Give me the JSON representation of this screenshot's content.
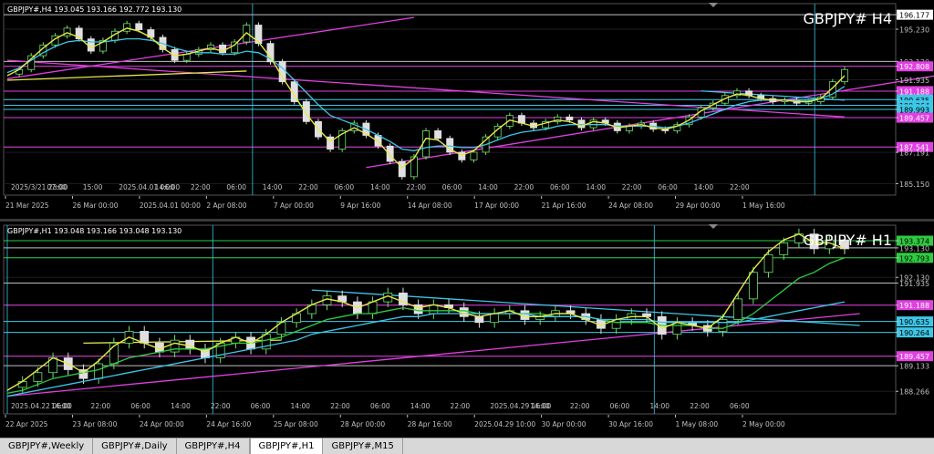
{
  "tabs": [
    "GBPJPY#,Weekly",
    "GBPJPY#,Daily",
    "GBPJPY#,H4",
    "GBPJPY#,H1",
    "GBPJPY#,M15"
  ],
  "active_tab": 3,
  "colors": {
    "bg": "#000000",
    "grid": "#2a2a2a",
    "axis": "#c0c0c0",
    "magenta": "#e040e0",
    "cyan": "#3ec6e6",
    "yellow": "#e8e84a",
    "green": "#2ecc40",
    "candle_up": "#6ee26e",
    "candle_dn": "#e0e0e0",
    "white_line": "#bbbbbb"
  },
  "charts": [
    {
      "id": "h4",
      "header": "GBPJPY#,H4  193.045 193.166 192.772 193.130",
      "big_label": "GBPJPY#  H4",
      "ylim": [
        184.4,
        196.9
      ],
      "price_labels": [
        {
          "text": "196.177",
          "value": 196.177,
          "bg": "#ffffff",
          "fg": "#000000"
        },
        {
          "text": "195.230",
          "value": 195.23,
          "bg": "",
          "fg": "#c0c0c0"
        },
        {
          "text": "193.130",
          "value": 193.13,
          "bg": "",
          "fg": "#c0c0c0"
        },
        {
          "text": "192.808",
          "value": 192.808,
          "bg": "#e040e0",
          "fg": "#ffffff"
        },
        {
          "text": "191.935",
          "value": 191.935,
          "bg": "",
          "fg": "#c0c0c0"
        },
        {
          "text": "191.188",
          "value": 191.188,
          "bg": "#e040e0",
          "fg": "#ffffff"
        },
        {
          "text": "190.635",
          "value": 190.635,
          "bg": "#3ec6e6",
          "fg": "#000000"
        },
        {
          "text": "190.264",
          "value": 190.264,
          "bg": "#3ec6e6",
          "fg": "#000000"
        },
        {
          "text": "189.993",
          "value": 189.993,
          "bg": "#3ec6e6",
          "fg": "#000000"
        },
        {
          "text": "189.457",
          "value": 189.457,
          "bg": "#e040e0",
          "fg": "#ffffff"
        },
        {
          "text": "187.541",
          "value": 187.541,
          "bg": "#e040e0",
          "fg": "#ffffff"
        },
        {
          "text": "187.191",
          "value": 187.191,
          "bg": "",
          "fg": "#c0c0c0"
        },
        {
          "text": "185.150",
          "value": 185.15,
          "bg": "",
          "fg": "#c0c0c0"
        }
      ],
      "hlines": [
        {
          "value": 196.177,
          "color": "#bbbbbb"
        },
        {
          "value": 193.13,
          "color": "#bbbbbb"
        },
        {
          "value": 192.808,
          "color": "#e040e0"
        },
        {
          "value": 191.188,
          "color": "#e040e0"
        },
        {
          "value": 190.635,
          "color": "#3ec6e6"
        },
        {
          "value": 190.264,
          "color": "#3ec6e6"
        },
        {
          "value": 189.993,
          "color": "#3ec6e6"
        },
        {
          "value": 189.457,
          "color": "#e040e0"
        },
        {
          "value": 187.541,
          "color": "#e040e0"
        }
      ],
      "time_labels_top": [
        "2025/3/21 23:00",
        "07:00",
        "15:00",
        "2025.04.01 06:00",
        "14:00",
        "22:00",
        "06:00",
        "14:00",
        "22:00",
        "06:00",
        "14:00",
        "22:00",
        "06:00",
        "14:00",
        "22:00",
        "06:00",
        "14:00",
        "22:00",
        "06:00",
        "14:00",
        "22:00"
      ],
      "time_labels_bottom": [
        "21 Mar 2025",
        "26 Mar 00:00",
        "2025.04.01 00:00",
        "2 Apr 08:00",
        "7 Apr 00:00",
        "9 Apr 16:00",
        "14 Apr 08:00",
        "17 Apr 00:00",
        "21 Apr 16:00",
        "24 Apr 08:00",
        "29 Apr 00:00",
        "1 May 16:00"
      ],
      "price_path": [
        192.3,
        192.6,
        193.5,
        194.2,
        194.8,
        195.3,
        194.6,
        193.8,
        194.5,
        195.1,
        195.6,
        195.2,
        194.7,
        193.9,
        193.2,
        193.6,
        193.9,
        194.2,
        193.7,
        194.4,
        195.5,
        194.3,
        193.1,
        191.8,
        190.5,
        189.2,
        188.2,
        187.4,
        188.6,
        189.1,
        188.3,
        187.6,
        186.6,
        185.6,
        186.9,
        188.6,
        188.1,
        187.2,
        186.7,
        187.2,
        188.2,
        188.9,
        189.6,
        189.1,
        188.8,
        189.2,
        189.5,
        189.3,
        188.8,
        189.3,
        189.1,
        188.6,
        188.9,
        189.1,
        188.7,
        188.6,
        189.0,
        189.5,
        190.1,
        190.4,
        190.9,
        191.2,
        190.9,
        190.7,
        190.5,
        190.6,
        190.4,
        190.5,
        190.8,
        191.8,
        192.6
      ],
      "ma_cyan": [
        192.4,
        192.7,
        193.2,
        193.7,
        194.1,
        194.4,
        194.5,
        194.4,
        194.4,
        194.5,
        194.6,
        194.6,
        194.5,
        194.3,
        194.0,
        193.8,
        193.7,
        193.7,
        193.6,
        193.6,
        193.8,
        193.7,
        193.3,
        192.7,
        191.9,
        191.1,
        190.3,
        189.6,
        189.3,
        189.0,
        188.7,
        188.3,
        187.9,
        187.4,
        187.3,
        187.5,
        187.6,
        187.6,
        187.5,
        187.5,
        187.7,
        188.0,
        188.3,
        188.5,
        188.6,
        188.7,
        188.9,
        189.0,
        189.0,
        189.0,
        189.0,
        188.9,
        188.9,
        188.9,
        188.9,
        188.8,
        188.9,
        189.1,
        189.4,
        189.7,
        190.0,
        190.3,
        190.5,
        190.6,
        190.6,
        190.6,
        190.6,
        190.6,
        190.7,
        191.0,
        191.5
      ],
      "ma_yellow": [
        192.2,
        192.6,
        193.3,
        194.0,
        194.6,
        195.0,
        194.7,
        194.0,
        194.4,
        194.9,
        195.3,
        195.1,
        194.7,
        194.0,
        193.5,
        193.6,
        193.8,
        194.0,
        193.8,
        194.2,
        195.0,
        194.4,
        193.4,
        192.1,
        190.9,
        189.7,
        188.7,
        187.9,
        188.4,
        188.8,
        188.4,
        187.9,
        187.0,
        186.2,
        186.8,
        188.1,
        188.0,
        187.4,
        187.0,
        187.3,
        188.0,
        188.7,
        189.3,
        189.1,
        188.9,
        189.1,
        189.3,
        189.2,
        188.9,
        189.2,
        189.1,
        188.8,
        188.9,
        189.0,
        188.8,
        188.7,
        188.9,
        189.3,
        189.9,
        190.3,
        190.7,
        191.0,
        190.9,
        190.7,
        190.6,
        190.6,
        190.5,
        190.5,
        190.7,
        191.4,
        192.2
      ],
      "trendlines": [
        {
          "color": "#e040e0",
          "from": [
            0,
            192.0
          ],
          "to": [
            34,
            196.0
          ]
        },
        {
          "color": "#e040e0",
          "from": [
            0,
            193.2
          ],
          "to": [
            70,
            189.5
          ]
        },
        {
          "color": "#e040e0",
          "from": [
            30,
            186.2
          ],
          "to": [
            84,
            193.0
          ]
        },
        {
          "color": "#e8e84a",
          "from": [
            0,
            191.9
          ],
          "to": [
            20,
            192.5
          ]
        },
        {
          "color": "#3ec6e6",
          "from": [
            58,
            191.2
          ],
          "to": [
            70,
            190.6
          ]
        }
      ],
      "vlines": [
        20.5,
        67.5
      ]
    },
    {
      "id": "h1",
      "header": "GBPJPY#,H1  193.048 193.166 193.048 193.130",
      "big_label": "GBPJPY#  H1",
      "ylim": [
        187.5,
        193.9
      ],
      "price_labels": [
        {
          "text": "193.374",
          "value": 193.374,
          "bg": "#2ecc40",
          "fg": "#000000"
        },
        {
          "text": "193.130",
          "value": 193.13,
          "bg": "",
          "fg": "#c0c0c0"
        },
        {
          "text": "192.793",
          "value": 192.793,
          "bg": "#2ecc40",
          "fg": "#000000"
        },
        {
          "text": "192.130",
          "value": 192.13,
          "bg": "",
          "fg": "#c0c0c0"
        },
        {
          "text": "191.935",
          "value": 191.935,
          "bg": "",
          "fg": "#c0c0c0"
        },
        {
          "text": "191.188",
          "value": 191.188,
          "bg": "#e040e0",
          "fg": "#ffffff"
        },
        {
          "text": "190.635",
          "value": 190.635,
          "bg": "#3ec6e6",
          "fg": "#000000"
        },
        {
          "text": "190.264",
          "value": 190.264,
          "bg": "#3ec6e6",
          "fg": "#000000"
        },
        {
          "text": "189.457",
          "value": 189.457,
          "bg": "#e040e0",
          "fg": "#ffffff"
        },
        {
          "text": "189.133",
          "value": 189.133,
          "bg": "",
          "fg": "#c0c0c0"
        },
        {
          "text": "188.266",
          "value": 188.266,
          "bg": "",
          "fg": "#c0c0c0"
        }
      ],
      "hlines": [
        {
          "value": 193.374,
          "color": "#2ecc40"
        },
        {
          "value": 193.13,
          "color": "#bbbbbb"
        },
        {
          "value": 192.793,
          "color": "#2ecc40"
        },
        {
          "value": 191.935,
          "color": "#bbbbbb"
        },
        {
          "value": 191.188,
          "color": "#e040e0"
        },
        {
          "value": 190.635,
          "color": "#3ec6e6"
        },
        {
          "value": 190.264,
          "color": "#3ec6e6"
        },
        {
          "value": 189.457,
          "color": "#e040e0"
        },
        {
          "value": 189.133,
          "color": "#bbbbbb"
        }
      ],
      "time_labels_top": [
        "2025.04.22 06:00",
        "14:00",
        "22:00",
        "06:00",
        "14:00",
        "22:00",
        "06:00",
        "14:00",
        "22:00",
        "06:00",
        "14:00",
        "22:00",
        "2025.04.29 16:00",
        "14:00",
        "22:00",
        "06:00",
        "14:00",
        "22:00",
        "06:00"
      ],
      "time_labels_bottom": [
        "22 Apr 2025",
        "23 Apr 08:00",
        "24 Apr 00:00",
        "24 Apr 16:00",
        "25 Apr 08:00",
        "28 Apr 00:00",
        "28 Apr 16:00",
        "2025.04.29 10:00",
        "30 Apr 00:00",
        "30 Apr 16:00",
        "1 May 08:00",
        "2 May 00:00"
      ],
      "price_path": [
        188.4,
        188.6,
        188.9,
        189.4,
        189.0,
        188.7,
        189.2,
        189.9,
        190.3,
        189.9,
        189.6,
        190.0,
        189.7,
        189.4,
        189.9,
        190.1,
        189.7,
        190.2,
        190.6,
        190.9,
        191.2,
        191.5,
        191.3,
        190.9,
        191.3,
        191.6,
        191.2,
        190.9,
        191.2,
        191.1,
        190.8,
        190.6,
        190.9,
        191.0,
        190.7,
        190.8,
        191.0,
        190.9,
        190.7,
        190.4,
        190.7,
        190.9,
        190.8,
        190.2,
        190.6,
        190.5,
        190.3,
        190.7,
        191.4,
        192.3,
        192.9,
        193.3,
        193.6,
        193.1,
        193.4,
        193.1
      ],
      "ma_green": [
        188.2,
        188.3,
        188.5,
        188.7,
        188.8,
        188.9,
        189.0,
        189.2,
        189.4,
        189.5,
        189.6,
        189.7,
        189.7,
        189.7,
        189.8,
        189.9,
        189.9,
        190.0,
        190.1,
        190.3,
        190.5,
        190.7,
        190.8,
        190.9,
        190.9,
        191.0,
        191.1,
        191.0,
        191.0,
        191.0,
        191.0,
        190.9,
        190.9,
        190.9,
        190.9,
        190.9,
        190.8,
        190.8,
        190.8,
        190.7,
        190.6,
        190.6,
        190.6,
        190.5,
        190.5,
        190.5,
        190.4,
        190.4,
        190.6,
        190.9,
        191.3,
        191.7,
        192.1,
        192.3,
        192.6,
        192.8
      ],
      "ma_cyan": [
        188.1,
        188.2,
        188.3,
        188.4,
        188.5,
        188.6,
        188.7,
        188.8,
        188.9,
        189.0,
        189.1,
        189.2,
        189.3,
        189.4,
        189.5,
        189.6,
        189.7,
        189.8,
        189.9,
        190.0,
        190.2,
        190.3,
        190.4,
        190.5,
        190.6,
        190.7,
        190.8,
        190.8,
        190.9,
        190.9,
        190.9,
        190.9,
        190.9,
        190.9,
        190.9,
        190.8,
        190.8,
        190.8,
        190.8,
        190.7,
        190.7,
        190.7,
        190.7,
        190.6,
        190.6,
        190.6,
        190.6,
        190.6,
        190.6,
        190.7,
        190.8,
        190.9,
        191.0,
        191.1,
        191.2,
        191.3
      ],
      "ma_yellow": [
        188.3,
        188.6,
        189.0,
        189.4,
        189.2,
        188.9,
        189.3,
        189.8,
        190.1,
        189.9,
        189.7,
        189.9,
        189.8,
        189.6,
        189.9,
        190.1,
        189.9,
        190.2,
        190.6,
        190.9,
        191.2,
        191.4,
        191.3,
        191.1,
        191.3,
        191.5,
        191.3,
        191.1,
        191.2,
        191.1,
        190.9,
        190.8,
        190.9,
        191.0,
        190.8,
        190.8,
        190.9,
        190.9,
        190.7,
        190.5,
        190.7,
        190.8,
        190.8,
        190.4,
        190.6,
        190.5,
        190.4,
        190.8,
        191.6,
        192.4,
        193.0,
        193.4,
        193.6,
        193.3,
        193.3,
        193.1
      ],
      "trendlines": [
        {
          "color": "#e040e0",
          "from": [
            0,
            188.1
          ],
          "to": [
            56,
            190.9
          ]
        },
        {
          "color": "#3ec6e6",
          "from": [
            20,
            191.7
          ],
          "to": [
            56,
            190.5
          ]
        },
        {
          "color": "#e8e84a",
          "from": [
            5,
            189.9
          ],
          "to": [
            18,
            190.0
          ]
        }
      ],
      "vlines": [
        0,
        13.5,
        42.5
      ]
    }
  ]
}
